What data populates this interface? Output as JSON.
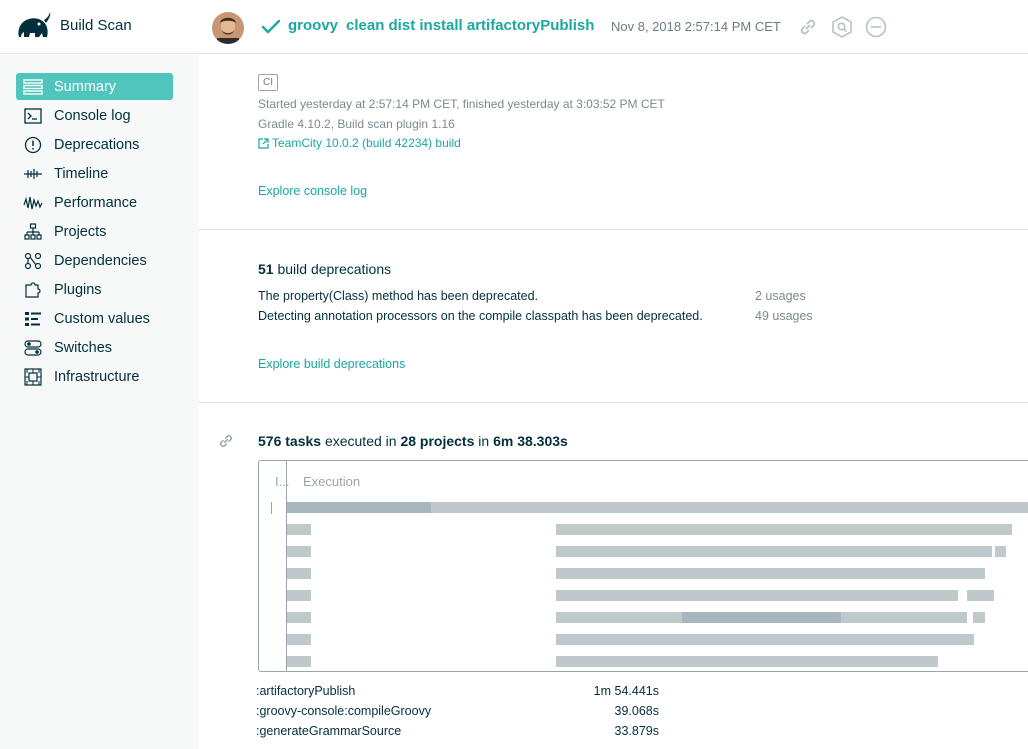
{
  "topbar": {
    "brand": "Build Scan",
    "project": "groovy",
    "tasks": "clean dist install artifactoryPublish",
    "timestamp": "Nov 8, 2018 2:57:14 PM CET"
  },
  "sidebar": {
    "items": [
      {
        "label": "Summary",
        "icon": "summary-icon"
      },
      {
        "label": "Console log",
        "icon": "console-icon"
      },
      {
        "label": "Deprecations",
        "icon": "warning-icon"
      },
      {
        "label": "Timeline",
        "icon": "timeline-icon"
      },
      {
        "label": "Performance",
        "icon": "performance-icon"
      },
      {
        "label": "Projects",
        "icon": "projects-icon"
      },
      {
        "label": "Dependencies",
        "icon": "dependencies-icon"
      },
      {
        "label": "Plugins",
        "icon": "plugin-icon"
      },
      {
        "label": "Custom values",
        "icon": "custom-values-icon"
      },
      {
        "label": "Switches",
        "icon": "switches-icon"
      },
      {
        "label": "Infrastructure",
        "icon": "infrastructure-icon"
      }
    ]
  },
  "summary": {
    "ci_badge": "CI",
    "started": "Started yesterday at 2:57:14 PM CET, finished yesterday at 3:03:52 PM CET",
    "gradle": "Gradle 4.10.2,  Build scan plugin 1.16",
    "teamcity": "TeamCity 10.0.2 (build 42234) build",
    "explore": "Explore console log"
  },
  "deprecations": {
    "count": "51",
    "title_rest": "build deprecations",
    "rows": [
      {
        "text": "The property(Class) method has been deprecated.",
        "usages": "2 usages"
      },
      {
        "text": "Detecting annotation processors on the compile classpath has been deprecated.",
        "usages": "49 usages"
      }
    ],
    "explore": "Explore build deprecations"
  },
  "execution": {
    "tasks_count": "576 tasks",
    "executed_in": "executed in",
    "projects": "28 projects",
    "in": "in",
    "duration": "6m 38.303s",
    "col1_header": "I...",
    "col2_header": "Execution",
    "tasks": [
      {
        "name": ":artifactoryPublish",
        "duration": "1m 54.441s"
      },
      {
        "name": ":groovy-console:compileGroovy",
        "duration": "39.068s"
      },
      {
        "name": ":generateGrammarSource",
        "duration": "33.879s"
      }
    ]
  },
  "colors": {
    "accent": "#1ba8a0",
    "active_nav": "#4fc5be",
    "text": "#02303a"
  }
}
